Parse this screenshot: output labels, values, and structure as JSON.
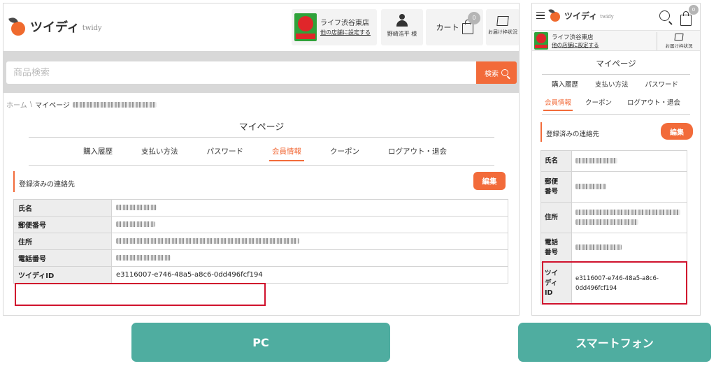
{
  "brand": {
    "name": "ツイディ",
    "sub": "twidy"
  },
  "store": {
    "name": "ライフ渋谷東店",
    "change_link": "他の店舗に設定する"
  },
  "user": {
    "name": "野崎浩平 様"
  },
  "cart": {
    "label": "カート",
    "count": "0"
  },
  "delivery": {
    "label": "お届け枠状況"
  },
  "search": {
    "placeholder": "商品検索",
    "button": "検索"
  },
  "breadcrumb": {
    "home": "ホーム",
    "separator": "\\",
    "current": "マイページ"
  },
  "page_title": "マイページ",
  "tabs": [
    {
      "label": "購入履歴"
    },
    {
      "label": "支払い方法"
    },
    {
      "label": "パスワード"
    },
    {
      "label": "会員情報",
      "active": true
    },
    {
      "label": "クーポン"
    },
    {
      "label": "ログアウト・退会"
    }
  ],
  "section": {
    "title": "登録済みの連絡先",
    "edit_button": "編集"
  },
  "member_info": {
    "labels": {
      "name": "氏名",
      "postal": "郵便番号",
      "address": "住所",
      "phone": "電話番号",
      "twidy_id": "ツイディID"
    },
    "sp_labels": {
      "postal": "郵便\n番号",
      "phone": "電話\n番号",
      "twidy_id": "ツイ\nディ\nID"
    },
    "twidy_id": "e3116007-e746-48a5-a8c6-0dd496fcf194",
    "twidy_id_sp": "e3116007-e746-48a5-a8c6-\n0dd496fcf194"
  },
  "device_labels": {
    "pc": "PC",
    "smartphone": "スマートフォン"
  },
  "colors": {
    "accent": "#f26b3a",
    "highlight": "#d0122d",
    "label_button": "#4fada0",
    "store_logo": "#2fa23a"
  },
  "icons": [
    "hamburger-icon",
    "search-icon",
    "bag-icon",
    "user-icon",
    "box-icon",
    "logo-icon"
  ]
}
